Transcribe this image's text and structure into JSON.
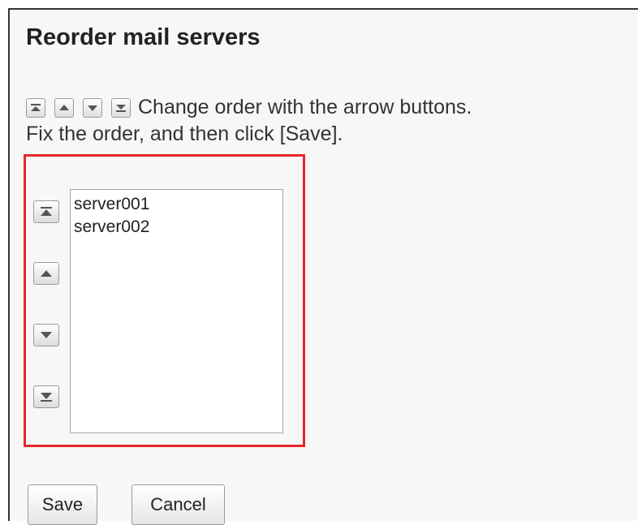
{
  "dialog": {
    "title": "Reorder mail servers",
    "instruction_line1": "Change order with the arrow buttons.",
    "instruction_line2": "Fix the order, and then click [Save]."
  },
  "order_controls": {
    "icons": [
      "move-to-top-icon",
      "move-up-icon",
      "move-down-icon",
      "move-to-bottom-icon"
    ]
  },
  "server_list": {
    "items": [
      "server001",
      "server002"
    ]
  },
  "actions": {
    "save_label": "Save",
    "cancel_label": "Cancel"
  },
  "colors": {
    "highlight_border": "#e8262b",
    "panel_background": "#f7f7f7",
    "icon_color": "#555555"
  }
}
